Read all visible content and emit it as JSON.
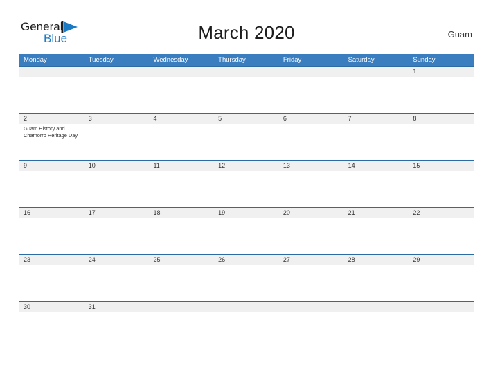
{
  "brand": {
    "name_part1": "General",
    "name_part2": "Blue",
    "logo_icon": "flag-triangle-icon",
    "color_dark": "#1d1d1d",
    "color_blue": "#1b7ac4"
  },
  "header": {
    "title": "March 2020",
    "region": "Guam"
  },
  "theme": {
    "header_blue": "#3a7ebf",
    "rule_blue": "#2d6ca2",
    "band_gray": "#f0f0f0",
    "text": "#222222"
  },
  "calendar": {
    "weekdays": [
      "Monday",
      "Tuesday",
      "Wednesday",
      "Thursday",
      "Friday",
      "Saturday",
      "Sunday"
    ],
    "weeks": [
      {
        "days": [
          {
            "num": "",
            "events": []
          },
          {
            "num": "",
            "events": []
          },
          {
            "num": "",
            "events": []
          },
          {
            "num": "",
            "events": []
          },
          {
            "num": "",
            "events": []
          },
          {
            "num": "",
            "events": []
          },
          {
            "num": "1",
            "events": []
          }
        ]
      },
      {
        "days": [
          {
            "num": "2",
            "events": [
              "Guam History and Chamorro Heritage Day"
            ]
          },
          {
            "num": "3",
            "events": []
          },
          {
            "num": "4",
            "events": []
          },
          {
            "num": "5",
            "events": []
          },
          {
            "num": "6",
            "events": []
          },
          {
            "num": "7",
            "events": []
          },
          {
            "num": "8",
            "events": []
          }
        ]
      },
      {
        "days": [
          {
            "num": "9",
            "events": []
          },
          {
            "num": "10",
            "events": []
          },
          {
            "num": "11",
            "events": []
          },
          {
            "num": "12",
            "events": []
          },
          {
            "num": "13",
            "events": []
          },
          {
            "num": "14",
            "events": []
          },
          {
            "num": "15",
            "events": []
          }
        ]
      },
      {
        "days": [
          {
            "num": "16",
            "events": []
          },
          {
            "num": "17",
            "events": []
          },
          {
            "num": "18",
            "events": []
          },
          {
            "num": "19",
            "events": []
          },
          {
            "num": "20",
            "events": []
          },
          {
            "num": "21",
            "events": []
          },
          {
            "num": "22",
            "events": []
          }
        ]
      },
      {
        "days": [
          {
            "num": "23",
            "events": []
          },
          {
            "num": "24",
            "events": []
          },
          {
            "num": "25",
            "events": []
          },
          {
            "num": "26",
            "events": []
          },
          {
            "num": "27",
            "events": []
          },
          {
            "num": "28",
            "events": []
          },
          {
            "num": "29",
            "events": []
          }
        ]
      },
      {
        "days": [
          {
            "num": "30",
            "events": []
          },
          {
            "num": "31",
            "events": []
          },
          {
            "num": "",
            "events": []
          },
          {
            "num": "",
            "events": []
          },
          {
            "num": "",
            "events": []
          },
          {
            "num": "",
            "events": []
          },
          {
            "num": "",
            "events": []
          }
        ]
      }
    ]
  }
}
